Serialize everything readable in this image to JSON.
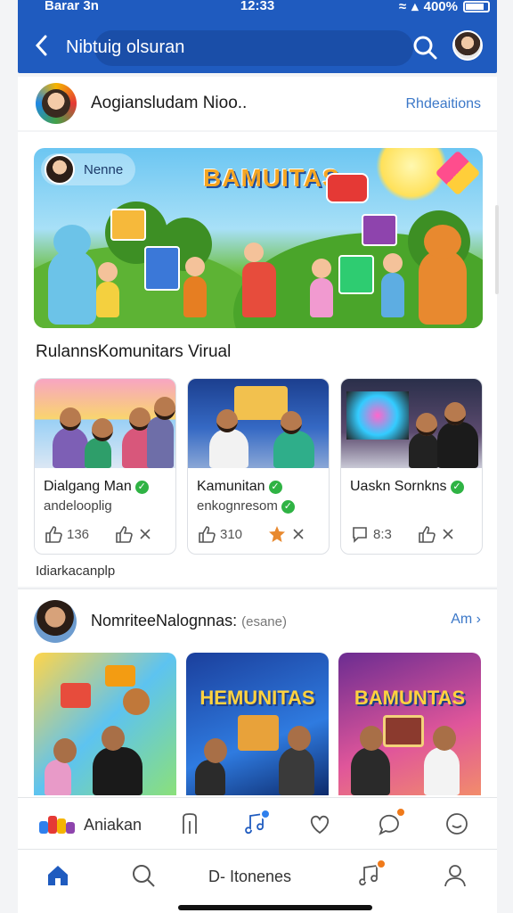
{
  "status_bar": {
    "carrier": "Barar 3n",
    "time": "12:33",
    "battery": "400%"
  },
  "header": {
    "title": "Nibtuig olsuran"
  },
  "post1": {
    "author": "Aogiansludam Nioo..",
    "action_link": "Rhdeaitions",
    "hero": {
      "chip_label": "Nenne",
      "title": "BAMUITAS"
    },
    "section_title": "RulannsKomunitars Virual",
    "tiles": [
      {
        "name": "Dialgang Man",
        "subtitle": "andelooplig",
        "count": "136"
      },
      {
        "name": "Kamunitan",
        "subtitle": "enkognresom",
        "count": "310"
      },
      {
        "name": "Uaskn Sornkns",
        "subtitle": "",
        "count": "8:3"
      }
    ],
    "caption": "Idiarkacanplp"
  },
  "post2": {
    "author": "NomriteeNalognnas:",
    "author_suffix": "(esane)",
    "action_link": "Am",
    "images": [
      {
        "title": ""
      },
      {
        "title": "HEMUNITAS"
      },
      {
        "title": "BAMUNTAS"
      }
    ]
  },
  "action_bar": {
    "label": "Aniakan"
  },
  "tab_bar": {
    "label": "D- Itonenes"
  },
  "colors": {
    "primary": "#1f5bbf",
    "link": "#3c78c8",
    "verified": "#2fb344",
    "notification": "#f07a1a"
  }
}
